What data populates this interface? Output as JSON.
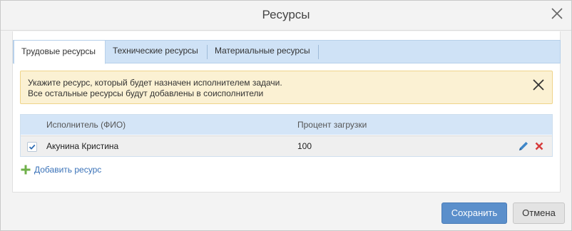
{
  "dialog": {
    "title": "Ресурсы"
  },
  "tabs": [
    {
      "label": "Трудовые ресурсы",
      "active": true
    },
    {
      "label": "Технические ресурсы",
      "active": false
    },
    {
      "label": "Материальные ресурсы",
      "active": false
    }
  ],
  "alert": {
    "line1": "Укажите ресурс, который будет назначен исполнителем задачи.",
    "line2": "Все остальные ресурсы будут добавлены в соисполнители",
    "background": "#fbf1d3"
  },
  "grid": {
    "columns": [
      "Исполнитель (ФИО)",
      "Процент загрузки"
    ],
    "rows": [
      {
        "checked": true,
        "name": "Акунина Кристина",
        "load": "100"
      }
    ],
    "header_color": "#d4e5f7"
  },
  "add_resource": {
    "label": "Добавить ресурс"
  },
  "footer": {
    "save_label": "Сохранить",
    "cancel_label": "Отмена",
    "primary_color": "#5b8fcb"
  },
  "icons": {
    "close": "close-icon",
    "edit": "pencil-icon",
    "delete": "delete-x-icon",
    "add": "plus-icon",
    "check": "checkmark-icon"
  }
}
